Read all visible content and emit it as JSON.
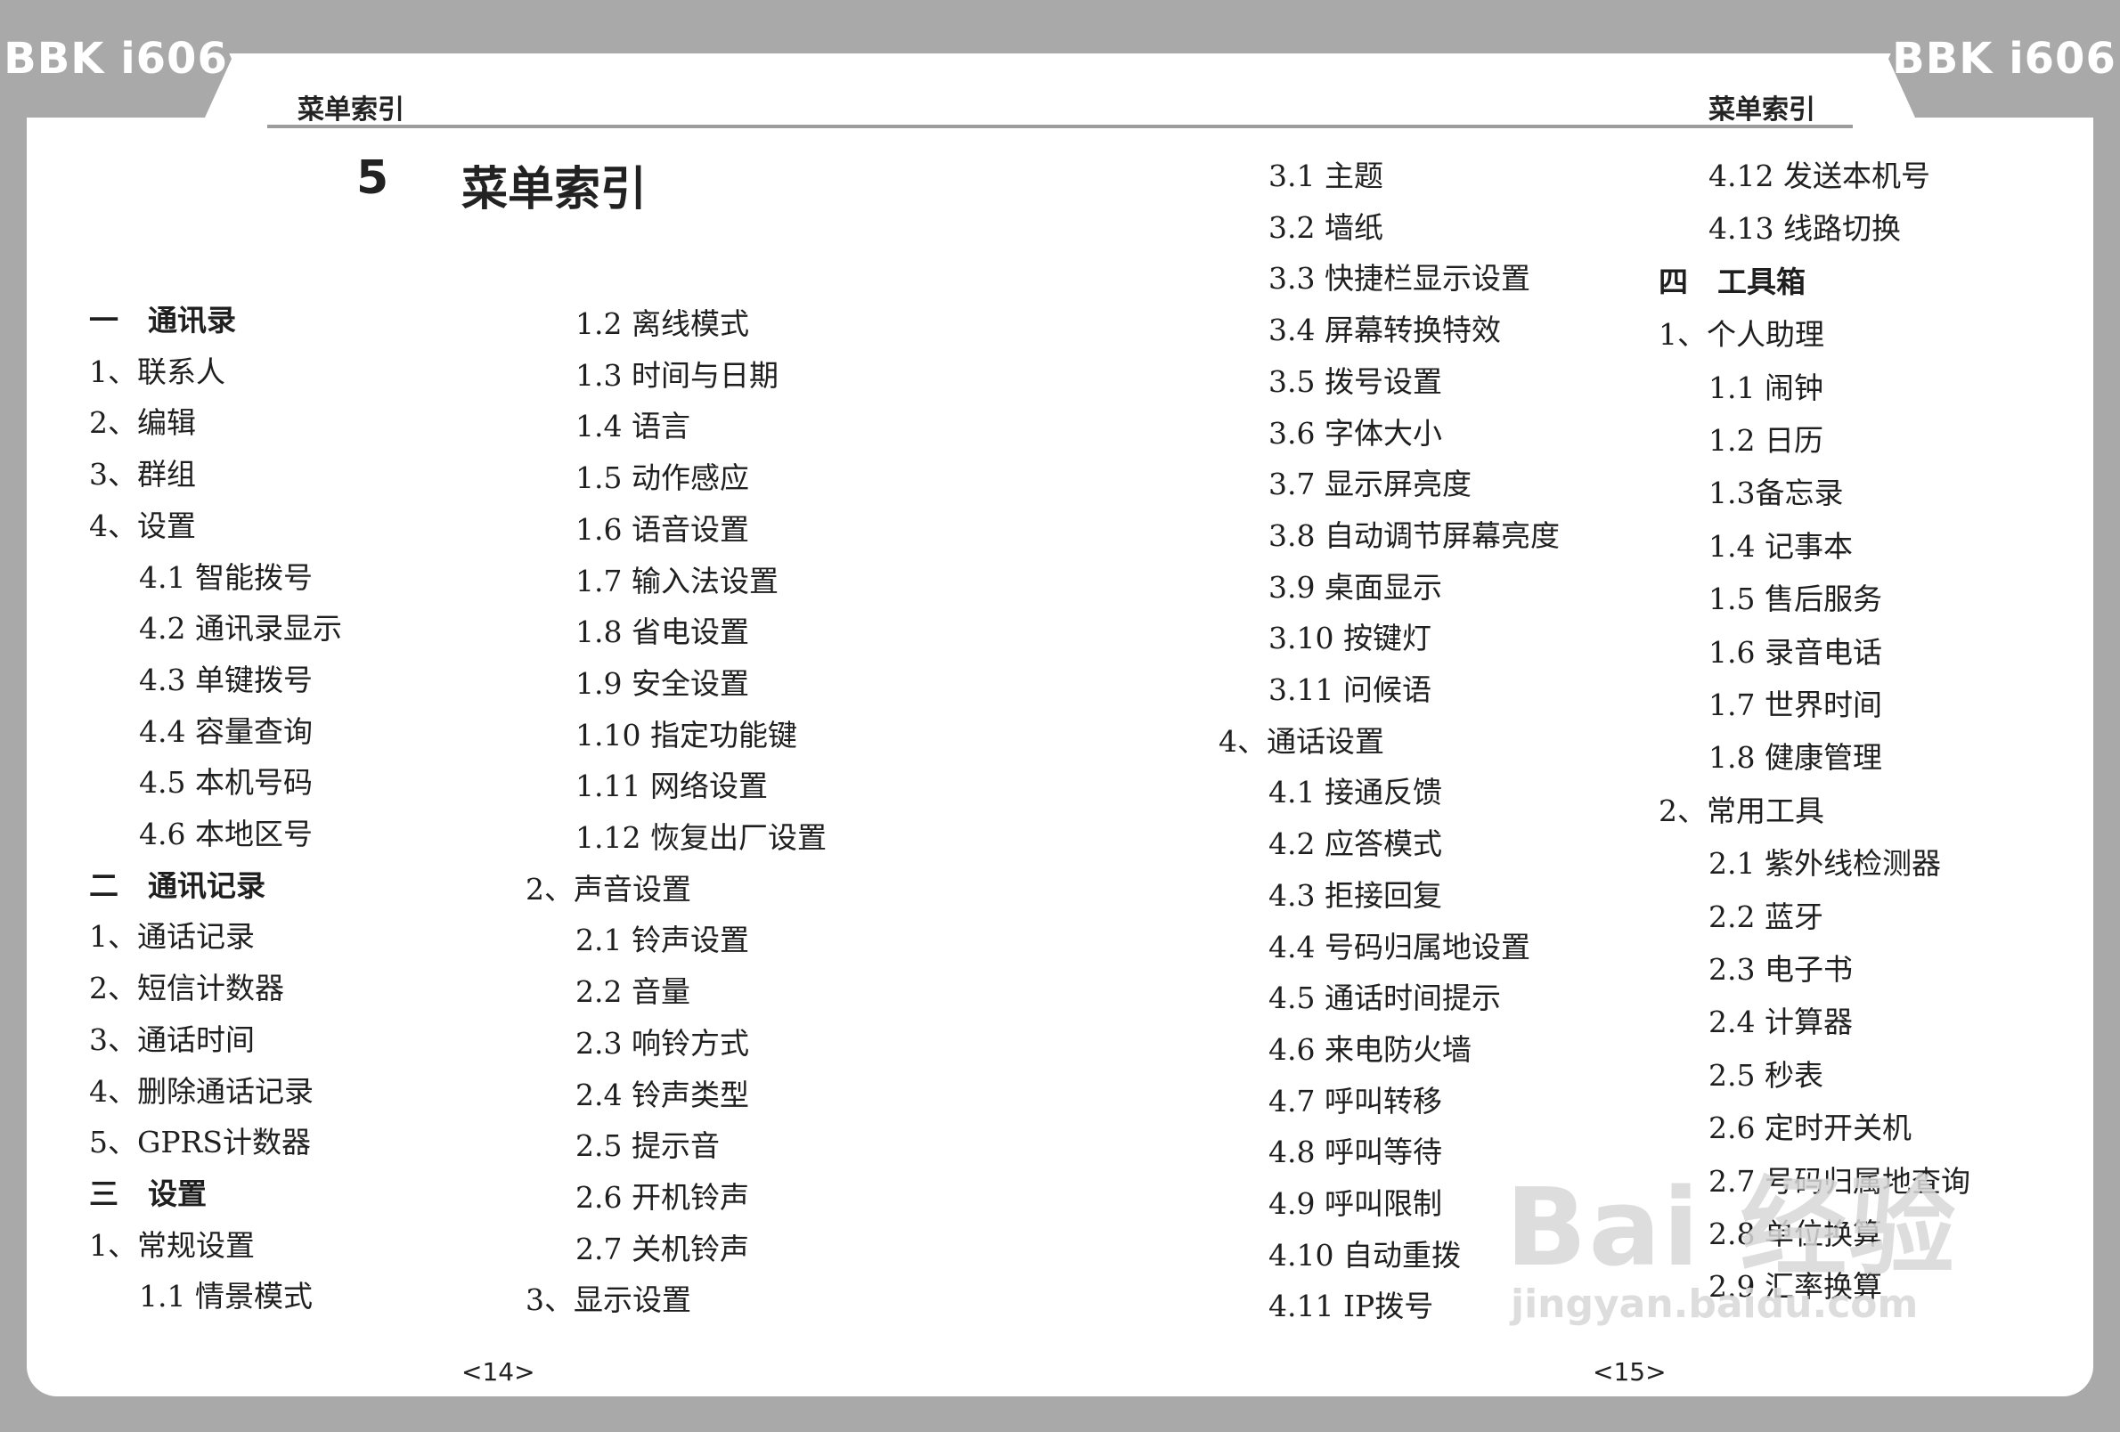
{
  "brand": {
    "left": "BBK i606",
    "right": "BBK i606"
  },
  "running_title": {
    "left": "菜单索引",
    "right": "菜单索引"
  },
  "chapter": {
    "number": "5",
    "title": "菜单索引"
  },
  "columns": [
    [
      "一　通讯录",
      "1、联系人",
      "2、编辑",
      "3、群组",
      "4、设置",
      "4.1 智能拨号",
      "4.2 通讯录显示",
      "4.3 单键拨号",
      "4.4 容量查询",
      "4.5 本机号码",
      "4.6 本地区号",
      "二　通讯记录",
      "1、通话记录",
      "2、短信计数器",
      "3、通话时间",
      "4、删除通话记录",
      "5、GPRS计数器",
      "三　设置",
      "1、常规设置",
      "1.1 情景模式"
    ],
    [
      "1.2 离线模式",
      "1.3 时间与日期",
      "1.4 语言",
      "1.5 动作感应",
      "1.6 语音设置",
      "1.7 输入法设置",
      "1.8 省电设置",
      "1.9 安全设置",
      "1.10 指定功能键",
      "1.11 网络设置",
      "1.12 恢复出厂设置",
      "2、声音设置",
      "2.1 铃声设置",
      "2.2 音量",
      "2.3 响铃方式",
      "2.4 铃声类型",
      "2.5 提示音",
      "2.6 开机铃声",
      "2.7 关机铃声",
      "3、显示设置"
    ],
    [
      "3.1 主题",
      "3.2 墙纸",
      "3.3 快捷栏显示设置",
      "3.4 屏幕转换特效",
      "3.5 拨号设置",
      "3.6 字体大小",
      "3.7 显示屏亮度",
      "3.8 自动调节屏幕亮度",
      "3.9 桌面显示",
      "3.10 按键灯",
      "3.11 问候语",
      "4、通话设置",
      "4.1 接通反馈",
      "4.2 应答模式",
      "4.3 拒接回复",
      "4.4 号码归属地设置",
      "4.5 通话时间提示",
      "4.6 来电防火墙",
      "4.7 呼叫转移",
      "4.8 呼叫等待",
      "4.9 呼叫限制",
      "4.10 自动重拨",
      "4.11 IP拨号"
    ],
    [
      "4.12 发送本机号",
      "4.13 线路切换",
      "四　工具箱",
      "1、个人助理",
      "1.1 闹钟",
      "1.2 日历",
      "1.3备忘录",
      "1.4 记事本",
      "1.5 售后服务",
      "1.6 录音电话",
      "1.7 世界时间",
      "1.8 健康管理",
      "2、常用工具",
      "2.1 紫外线检测器",
      "2.2 蓝牙",
      "2.3 电子书",
      "2.4 计算器",
      "2.5 秒表",
      "2.6 定时开关机",
      "2.7 号码归属地查询",
      "2.8 单位换算",
      "2.9 汇率换算"
    ]
  ],
  "page_numbers": {
    "left": "<14>",
    "right": "<15>"
  },
  "watermark": {
    "main": "Bai 经验",
    "sub": "jingyan.baidu.com"
  },
  "colors": {
    "frame": "#a9a9a9",
    "page": "#ffffff",
    "text": "#1f1f1f"
  }
}
